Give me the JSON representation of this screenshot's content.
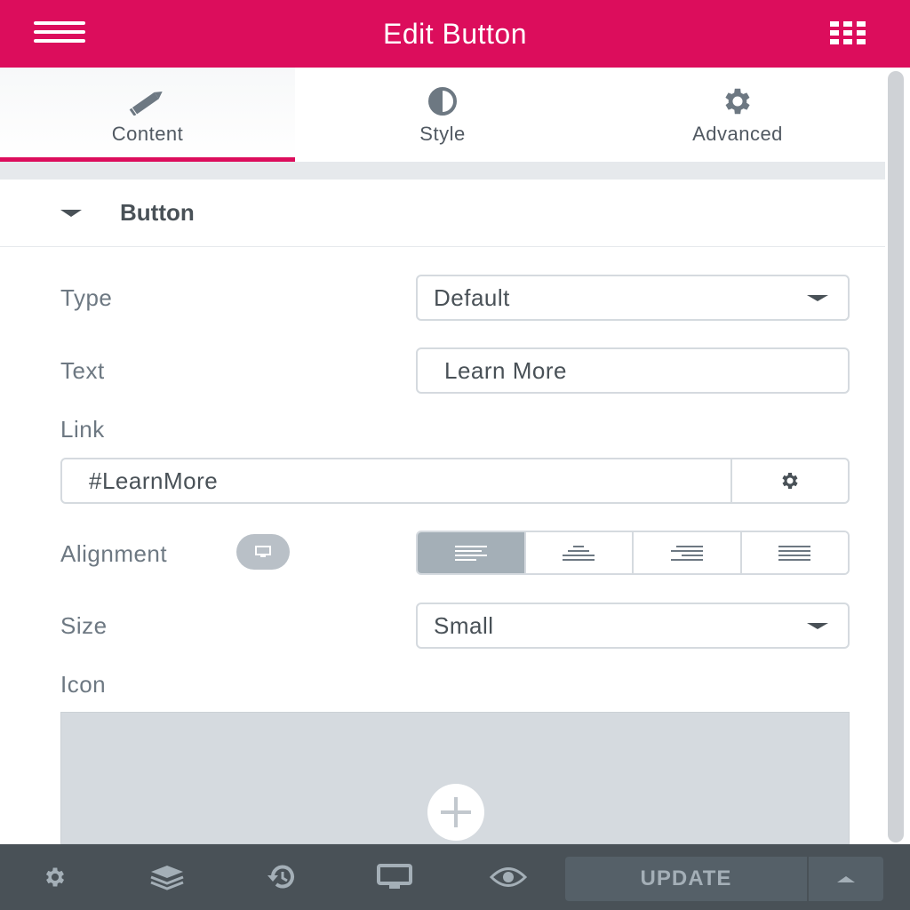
{
  "header": {
    "title": "Edit Button",
    "menu_icon": "hamburger-icon",
    "widgets_icon": "grid-icon"
  },
  "tabs": [
    {
      "label": "Content",
      "icon": "pencil-icon",
      "active": true
    },
    {
      "label": "Style",
      "icon": "half-circle-icon",
      "active": false
    },
    {
      "label": "Advanced",
      "icon": "gear-icon",
      "active": false
    }
  ],
  "section": {
    "title": "Button"
  },
  "fields": {
    "type": {
      "label": "Type",
      "value": "Default"
    },
    "text": {
      "label": "Text",
      "value": "Learn More"
    },
    "link": {
      "label": "Link",
      "value": "#LearnMore"
    },
    "alignment": {
      "label": "Alignment",
      "options": [
        "left",
        "center",
        "right",
        "justify"
      ],
      "selected": "left"
    },
    "size": {
      "label": "Size",
      "value": "Small"
    },
    "icon": {
      "label": "Icon"
    }
  },
  "footer": {
    "icons": [
      "gear-icon",
      "layers-icon",
      "history-icon",
      "desktop-icon",
      "eye-icon"
    ],
    "update_label": "UPDATE"
  },
  "colors": {
    "accent": "#dc0d5c",
    "footer_bg": "#495157",
    "active_align": "#a4afb7"
  }
}
